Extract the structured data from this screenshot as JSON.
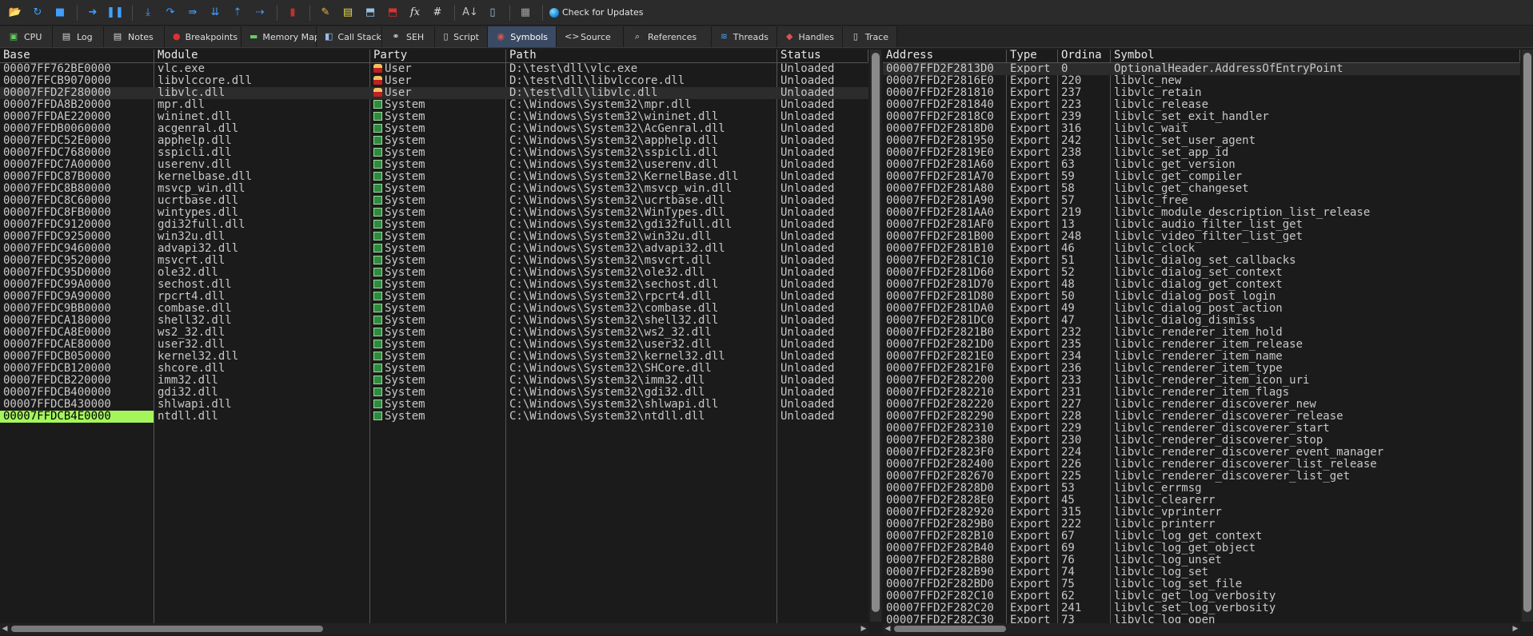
{
  "toolbar": {
    "buttons": [
      {
        "name": "open-icon",
        "glyph": "📂",
        "color": "#e8b84a"
      },
      {
        "name": "restart-icon",
        "glyph": "↻",
        "color": "#3fa0ff"
      },
      {
        "name": "stop-icon",
        "glyph": "■",
        "color": "#3fa0ff"
      },
      {
        "name": "run-icon",
        "glyph": "➜",
        "color": "#3fa0ff"
      },
      {
        "name": "pause-icon",
        "glyph": "❚❚",
        "color": "#3fa0ff"
      },
      {
        "name": "step-into-icon",
        "glyph": "⤓",
        "color": "#3fa0ff"
      },
      {
        "name": "step-over-icon",
        "glyph": "↷",
        "color": "#3fa0ff"
      },
      {
        "name": "trace-into-icon",
        "glyph": "⇛",
        "color": "#3fa0ff"
      },
      {
        "name": "trace-over-icon",
        "glyph": "⇊",
        "color": "#3fa0ff"
      },
      {
        "name": "execute-till-return-icon",
        "glyph": "⇡",
        "color": "#3fa0ff"
      },
      {
        "name": "run-to-user-code-icon",
        "glyph": "⇢",
        "color": "#3fa0ff"
      },
      {
        "name": "scylla-icon",
        "glyph": "▮",
        "color": "#c03030"
      },
      {
        "name": "patch-icon",
        "glyph": "✎",
        "color": "#e8b84a"
      },
      {
        "name": "comments-icon",
        "glyph": "▤",
        "color": "#e8d84a"
      },
      {
        "name": "labels-icon",
        "glyph": "⬒",
        "color": "#9ac0e0"
      },
      {
        "name": "bookmarks-icon",
        "glyph": "⬒",
        "color": "#e03030"
      },
      {
        "name": "functions-icon",
        "glyph": "fx",
        "color": "#e0e0e0"
      },
      {
        "name": "variables-icon",
        "glyph": "#",
        "color": "#e0e0e0"
      },
      {
        "name": "font-icon",
        "glyph": "A↓",
        "color": "#c0c0c0"
      },
      {
        "name": "preferences-icon",
        "glyph": "▯",
        "color": "#9ac0e0"
      },
      {
        "name": "calculator-icon",
        "glyph": "▦",
        "color": "#a0a0a0"
      }
    ],
    "update_label": "Check for Updates"
  },
  "tabs": [
    {
      "name": "cpu",
      "label": "CPU",
      "icon": "▣",
      "color": "#5fcf5f",
      "active": false
    },
    {
      "name": "log",
      "label": "Log",
      "icon": "▤",
      "color": "#d8d8d8",
      "active": false
    },
    {
      "name": "notes",
      "label": "Notes",
      "icon": "▤",
      "color": "#d8d8d8",
      "active": false
    },
    {
      "name": "breakpoints",
      "label": "Breakpoints",
      "icon": "●",
      "color": "#e03030",
      "active": false
    },
    {
      "name": "memory-map",
      "label": "Memory Map",
      "icon": "▬",
      "color": "#5fcf5f",
      "active": false
    },
    {
      "name": "call-stack",
      "label": "Call Stack",
      "icon": "◧",
      "color": "#9ab8e8",
      "active": false
    },
    {
      "name": "seh",
      "label": "SEH",
      "icon": "⚭",
      "color": "#d8d8d8",
      "active": false
    },
    {
      "name": "script",
      "label": "Script",
      "icon": "▯",
      "color": "#d8d8d8",
      "active": false
    },
    {
      "name": "symbols",
      "label": "Symbols",
      "icon": "◉",
      "color": "#e05050",
      "active": true
    },
    {
      "name": "source",
      "label": "Source",
      "icon": "<>",
      "color": "#d8d8d8",
      "active": false
    },
    {
      "name": "references",
      "label": "References",
      "icon": "⌕",
      "color": "#d8d8d8",
      "active": false
    },
    {
      "name": "threads",
      "label": "Threads",
      "icon": "≋",
      "color": "#4aa0ff",
      "active": false
    },
    {
      "name": "handles",
      "label": "Handles",
      "icon": "◆",
      "color": "#e05050",
      "active": false
    },
    {
      "name": "trace",
      "label": "Trace",
      "icon": "▯",
      "color": "#d8d8d8",
      "active": false
    }
  ],
  "modules": {
    "headers": [
      "Base",
      "Module",
      "Party",
      "Path",
      "Status"
    ],
    "rows": [
      [
        "00007FF762BE0000",
        "vlc.exe",
        "User",
        "D:\\test\\dll\\vlc.exe",
        "Unloaded"
      ],
      [
        "00007FFCB9070000",
        "libvlccore.dll",
        "User",
        "D:\\test\\dll\\libvlccore.dll",
        "Unloaded"
      ],
      [
        "00007FFD2F280000",
        "libvlc.dll",
        "User",
        "D:\\test\\dll\\libvlc.dll",
        "Unloaded"
      ],
      [
        "00007FFDA8B20000",
        "mpr.dll",
        "System",
        "C:\\Windows\\System32\\mpr.dll",
        "Unloaded"
      ],
      [
        "00007FFDAE220000",
        "wininet.dll",
        "System",
        "C:\\Windows\\System32\\wininet.dll",
        "Unloaded"
      ],
      [
        "00007FFDB0060000",
        "acgenral.dll",
        "System",
        "C:\\Windows\\System32\\AcGenral.dll",
        "Unloaded"
      ],
      [
        "00007FFDC52E0000",
        "apphelp.dll",
        "System",
        "C:\\Windows\\System32\\apphelp.dll",
        "Unloaded"
      ],
      [
        "00007FFDC7680000",
        "sspicli.dll",
        "System",
        "C:\\Windows\\System32\\sspicli.dll",
        "Unloaded"
      ],
      [
        "00007FFDC7A00000",
        "userenv.dll",
        "System",
        "C:\\Windows\\System32\\userenv.dll",
        "Unloaded"
      ],
      [
        "00007FFDC87B0000",
        "kernelbase.dll",
        "System",
        "C:\\Windows\\System32\\KernelBase.dll",
        "Unloaded"
      ],
      [
        "00007FFDC8B80000",
        "msvcp_win.dll",
        "System",
        "C:\\Windows\\System32\\msvcp_win.dll",
        "Unloaded"
      ],
      [
        "00007FFDC8C60000",
        "ucrtbase.dll",
        "System",
        "C:\\Windows\\System32\\ucrtbase.dll",
        "Unloaded"
      ],
      [
        "00007FFDC8FB0000",
        "wintypes.dll",
        "System",
        "C:\\Windows\\System32\\WinTypes.dll",
        "Unloaded"
      ],
      [
        "00007FFDC9120000",
        "gdi32full.dll",
        "System",
        "C:\\Windows\\System32\\gdi32full.dll",
        "Unloaded"
      ],
      [
        "00007FFDC9250000",
        "win32u.dll",
        "System",
        "C:\\Windows\\System32\\win32u.dll",
        "Unloaded"
      ],
      [
        "00007FFDC9460000",
        "advapi32.dll",
        "System",
        "C:\\Windows\\System32\\advapi32.dll",
        "Unloaded"
      ],
      [
        "00007FFDC9520000",
        "msvcrt.dll",
        "System",
        "C:\\Windows\\System32\\msvcrt.dll",
        "Unloaded"
      ],
      [
        "00007FFDC95D0000",
        "ole32.dll",
        "System",
        "C:\\Windows\\System32\\ole32.dll",
        "Unloaded"
      ],
      [
        "00007FFDC99A0000",
        "sechost.dll",
        "System",
        "C:\\Windows\\System32\\sechost.dll",
        "Unloaded"
      ],
      [
        "00007FFDC9A90000",
        "rpcrt4.dll",
        "System",
        "C:\\Windows\\System32\\rpcrt4.dll",
        "Unloaded"
      ],
      [
        "00007FFDC9BB0000",
        "combase.dll",
        "System",
        "C:\\Windows\\System32\\combase.dll",
        "Unloaded"
      ],
      [
        "00007FFDCA180000",
        "shell32.dll",
        "System",
        "C:\\Windows\\System32\\shell32.dll",
        "Unloaded"
      ],
      [
        "00007FFDCA8E0000",
        "ws2_32.dll",
        "System",
        "C:\\Windows\\System32\\ws2_32.dll",
        "Unloaded"
      ],
      [
        "00007FFDCAE80000",
        "user32.dll",
        "System",
        "C:\\Windows\\System32\\user32.dll",
        "Unloaded"
      ],
      [
        "00007FFDCB050000",
        "kernel32.dll",
        "System",
        "C:\\Windows\\System32\\kernel32.dll",
        "Unloaded"
      ],
      [
        "00007FFDCB120000",
        "shcore.dll",
        "System",
        "C:\\Windows\\System32\\SHCore.dll",
        "Unloaded"
      ],
      [
        "00007FFDCB220000",
        "imm32.dll",
        "System",
        "C:\\Windows\\System32\\imm32.dll",
        "Unloaded"
      ],
      [
        "00007FFDCB400000",
        "gdi32.dll",
        "System",
        "C:\\Windows\\System32\\gdi32.dll",
        "Unloaded"
      ],
      [
        "00007FFDCB430000",
        "shlwapi.dll",
        "System",
        "C:\\Windows\\System32\\shlwapi.dll",
        "Unloaded"
      ],
      [
        "00007FFDCB4E0000",
        "ntdll.dll",
        "System",
        "C:\\Windows\\System32\\ntdll.dll",
        "Unloaded"
      ]
    ]
  },
  "symbols": {
    "headers": [
      "Address",
      "Type",
      "Ordina",
      "Symbol"
    ],
    "rows": [
      [
        "00007FFD2F2813D0",
        "Export",
        "0",
        "OptionalHeader.AddressOfEntryPoint"
      ],
      [
        "00007FFD2F2816E0",
        "Export",
        "220",
        "libvlc_new"
      ],
      [
        "00007FFD2F281810",
        "Export",
        "237",
        "libvlc_retain"
      ],
      [
        "00007FFD2F281840",
        "Export",
        "223",
        "libvlc_release"
      ],
      [
        "00007FFD2F2818C0",
        "Export",
        "239",
        "libvlc_set_exit_handler"
      ],
      [
        "00007FFD2F2818D0",
        "Export",
        "316",
        "libvlc_wait"
      ],
      [
        "00007FFD2F281950",
        "Export",
        "242",
        "libvlc_set_user_agent"
      ],
      [
        "00007FFD2F2819E0",
        "Export",
        "238",
        "libvlc_set_app_id"
      ],
      [
        "00007FFD2F281A60",
        "Export",
        "63",
        "libvlc_get_version"
      ],
      [
        "00007FFD2F281A70",
        "Export",
        "59",
        "libvlc_get_compiler"
      ],
      [
        "00007FFD2F281A80",
        "Export",
        "58",
        "libvlc_get_changeset"
      ],
      [
        "00007FFD2F281A90",
        "Export",
        "57",
        "libvlc_free"
      ],
      [
        "00007FFD2F281AA0",
        "Export",
        "219",
        "libvlc_module_description_list_release"
      ],
      [
        "00007FFD2F281AF0",
        "Export",
        "13",
        "libvlc_audio_filter_list_get"
      ],
      [
        "00007FFD2F281B00",
        "Export",
        "248",
        "libvlc_video_filter_list_get"
      ],
      [
        "00007FFD2F281B10",
        "Export",
        "46",
        "libvlc_clock"
      ],
      [
        "00007FFD2F281C10",
        "Export",
        "51",
        "libvlc_dialog_set_callbacks"
      ],
      [
        "00007FFD2F281D60",
        "Export",
        "52",
        "libvlc_dialog_set_context"
      ],
      [
        "00007FFD2F281D70",
        "Export",
        "48",
        "libvlc_dialog_get_context"
      ],
      [
        "00007FFD2F281D80",
        "Export",
        "50",
        "libvlc_dialog_post_login"
      ],
      [
        "00007FFD2F281DA0",
        "Export",
        "49",
        "libvlc_dialog_post_action"
      ],
      [
        "00007FFD2F281DC0",
        "Export",
        "47",
        "libvlc_dialog_dismiss"
      ],
      [
        "00007FFD2F2821B0",
        "Export",
        "232",
        "libvlc_renderer_item_hold"
      ],
      [
        "00007FFD2F2821D0",
        "Export",
        "235",
        "libvlc_renderer_item_release"
      ],
      [
        "00007FFD2F2821E0",
        "Export",
        "234",
        "libvlc_renderer_item_name"
      ],
      [
        "00007FFD2F2821F0",
        "Export",
        "236",
        "libvlc_renderer_item_type"
      ],
      [
        "00007FFD2F282200",
        "Export",
        "233",
        "libvlc_renderer_item_icon_uri"
      ],
      [
        "00007FFD2F282210",
        "Export",
        "231",
        "libvlc_renderer_item_flags"
      ],
      [
        "00007FFD2F282220",
        "Export",
        "227",
        "libvlc_renderer_discoverer_new"
      ],
      [
        "00007FFD2F282290",
        "Export",
        "228",
        "libvlc_renderer_discoverer_release"
      ],
      [
        "00007FFD2F282310",
        "Export",
        "229",
        "libvlc_renderer_discoverer_start"
      ],
      [
        "00007FFD2F282380",
        "Export",
        "230",
        "libvlc_renderer_discoverer_stop"
      ],
      [
        "00007FFD2F2823F0",
        "Export",
        "224",
        "libvlc_renderer_discoverer_event_manager"
      ],
      [
        "00007FFD2F282400",
        "Export",
        "226",
        "libvlc_renderer_discoverer_list_release"
      ],
      [
        "00007FFD2F282670",
        "Export",
        "225",
        "libvlc_renderer_discoverer_list_get"
      ],
      [
        "00007FFD2F2828D0",
        "Export",
        "53",
        "libvlc_errmsg"
      ],
      [
        "00007FFD2F2828E0",
        "Export",
        "45",
        "libvlc_clearerr"
      ],
      [
        "00007FFD2F282920",
        "Export",
        "315",
        "libvlc_vprinterr"
      ],
      [
        "00007FFD2F2829B0",
        "Export",
        "222",
        "libvlc_printerr"
      ],
      [
        "00007FFD2F282B10",
        "Export",
        "67",
        "libvlc_log_get_context"
      ],
      [
        "00007FFD2F282B40",
        "Export",
        "69",
        "libvlc_log_get_object"
      ],
      [
        "00007FFD2F282B80",
        "Export",
        "76",
        "libvlc_log_unset"
      ],
      [
        "00007FFD2F282B90",
        "Export",
        "74",
        "libvlc_log_set"
      ],
      [
        "00007FFD2F282BD0",
        "Export",
        "75",
        "libvlc_log_set_file"
      ],
      [
        "00007FFD2F282C10",
        "Export",
        "62",
        "libvlc_get_log_verbosity"
      ],
      [
        "00007FFD2F282C20",
        "Export",
        "241",
        "libvlc_set_log_verbosity"
      ],
      [
        "00007FFD2F282C30",
        "Export",
        "73",
        "libvlc_log_open"
      ]
    ]
  },
  "colors": {
    "selected_base_highlight": "#a4f55c",
    "active_tab": "#3b4a63",
    "background": "#1b1b1b"
  }
}
